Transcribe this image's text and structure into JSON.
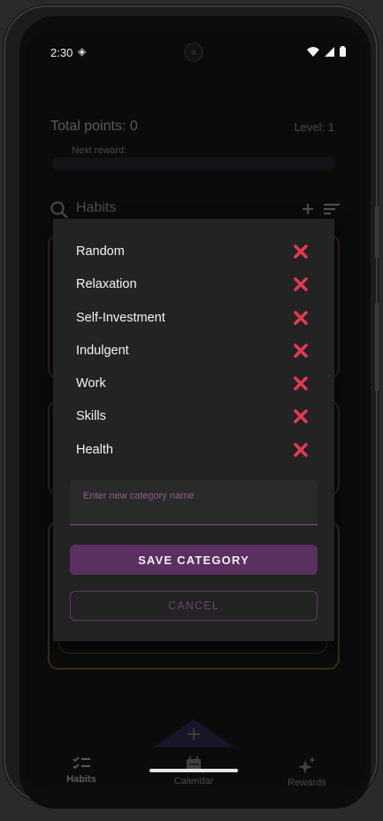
{
  "status_bar": {
    "time": "2:30"
  },
  "header": {
    "total_points": "Total points: 0",
    "level": "Level: 1",
    "next_reward": "Next reward:"
  },
  "habits_bar": {
    "title": "Habits"
  },
  "dialog": {
    "categories": [
      "Random",
      "Relaxation",
      "Self-Investment",
      "Indulgent",
      "Work",
      "Skills",
      "Health"
    ],
    "input_placeholder": "Enter new category name",
    "input_value": "",
    "save_label": "SAVE CATEGORY",
    "cancel_label": "CANCEL"
  },
  "bottom_nav": {
    "items": [
      {
        "label": "Habits",
        "icon": "checklist-icon",
        "active": true
      },
      {
        "label": "Calendar",
        "icon": "calendar-icon",
        "active": false
      },
      {
        "label": "Rewards",
        "icon": "sparkle-icon",
        "active": false
      }
    ]
  },
  "colors": {
    "accent": "#5a3060",
    "delete": "#e53950",
    "dialog_bg": "#232323"
  }
}
